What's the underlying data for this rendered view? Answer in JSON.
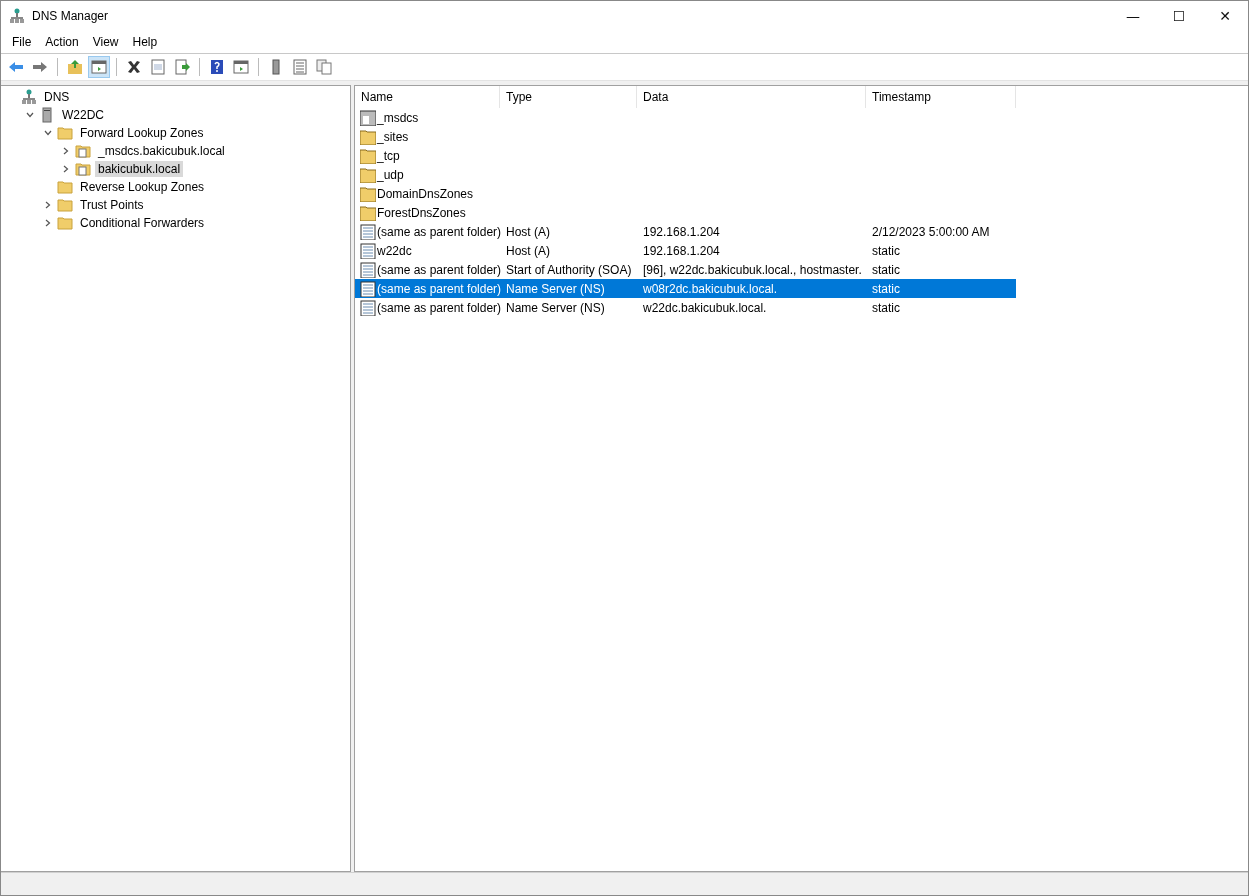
{
  "window": {
    "title": "DNS Manager",
    "controls": [
      "—",
      "☐",
      "✕"
    ]
  },
  "menu": [
    "File",
    "Action",
    "View",
    "Help"
  ],
  "toolbar": [
    {
      "kind": "back",
      "pressed": false
    },
    {
      "kind": "forward",
      "pressed": false
    },
    {
      "kind": "sep"
    },
    {
      "kind": "up",
      "pressed": false
    },
    {
      "kind": "tree",
      "pressed": true
    },
    {
      "kind": "sep"
    },
    {
      "kind": "delete",
      "pressed": false
    },
    {
      "kind": "properties",
      "pressed": false
    },
    {
      "kind": "export",
      "pressed": false
    },
    {
      "kind": "sep"
    },
    {
      "kind": "help",
      "pressed": false
    },
    {
      "kind": "pane",
      "pressed": false
    },
    {
      "kind": "sep"
    },
    {
      "kind": "server",
      "pressed": false
    },
    {
      "kind": "records",
      "pressed": false
    },
    {
      "kind": "copy",
      "pressed": false
    }
  ],
  "tree": [
    {
      "label": "DNS",
      "kind": "dns",
      "selected": false,
      "children": [
        {
          "label": "W22DC",
          "kind": "server",
          "expanded": true,
          "selected": false,
          "children": [
            {
              "label": "Forward Lookup Zones",
              "kind": "folder",
              "expanded": true,
              "selected": false,
              "children": [
                {
                  "label": "_msdcs.bakicubuk.local",
                  "kind": "zone",
                  "expanded": false,
                  "selected": false
                },
                {
                  "label": "bakicubuk.local",
                  "kind": "zone",
                  "expanded": false,
                  "selected": true
                }
              ]
            },
            {
              "label": "Reverse Lookup Zones",
              "kind": "folder",
              "selected": false
            },
            {
              "label": "Trust Points",
              "kind": "folder",
              "expanded": false,
              "selected": false
            },
            {
              "label": "Conditional Forwarders",
              "kind": "folder",
              "expanded": false,
              "selected": false
            }
          ]
        }
      ]
    }
  ],
  "table": {
    "columns": [
      "Name",
      "Type",
      "Data",
      "Timestamp"
    ],
    "rows": [
      {
        "kind": "delegation",
        "name": "_msdcs",
        "type": "",
        "data": "",
        "timestamp": "",
        "selected": false
      },
      {
        "kind": "folder",
        "name": "_sites",
        "type": "",
        "data": "",
        "timestamp": "",
        "selected": false
      },
      {
        "kind": "folder",
        "name": "_tcp",
        "type": "",
        "data": "",
        "timestamp": "",
        "selected": false
      },
      {
        "kind": "folder",
        "name": "_udp",
        "type": "",
        "data": "",
        "timestamp": "",
        "selected": false
      },
      {
        "kind": "folder",
        "name": "DomainDnsZones",
        "type": "",
        "data": "",
        "timestamp": "",
        "selected": false
      },
      {
        "kind": "folder",
        "name": "ForestDnsZones",
        "type": "",
        "data": "",
        "timestamp": "",
        "selected": false
      },
      {
        "kind": "record",
        "name": "(same as parent folder)",
        "type": "Host (A)",
        "data": "192.168.1.204",
        "timestamp": "2/12/2023 5:00:00 AM",
        "selected": false
      },
      {
        "kind": "record",
        "name": "w22dc",
        "type": "Host (A)",
        "data": "192.168.1.204",
        "timestamp": "static",
        "selected": false
      },
      {
        "kind": "record",
        "name": "(same as parent folder)",
        "type": "Start of Authority (SOA)",
        "data": "[96], w22dc.bakicubuk.local., hostmaster.",
        "timestamp": "static",
        "selected": false
      },
      {
        "kind": "record",
        "name": "(same as parent folder)",
        "type": "Name Server (NS)",
        "data": "w08r2dc.bakicubuk.local.",
        "timestamp": "static",
        "selected": true
      },
      {
        "kind": "record",
        "name": "(same as parent folder)",
        "type": "Name Server (NS)",
        "data": "w22dc.bakicubuk.local.",
        "timestamp": "static",
        "selected": false
      }
    ]
  }
}
